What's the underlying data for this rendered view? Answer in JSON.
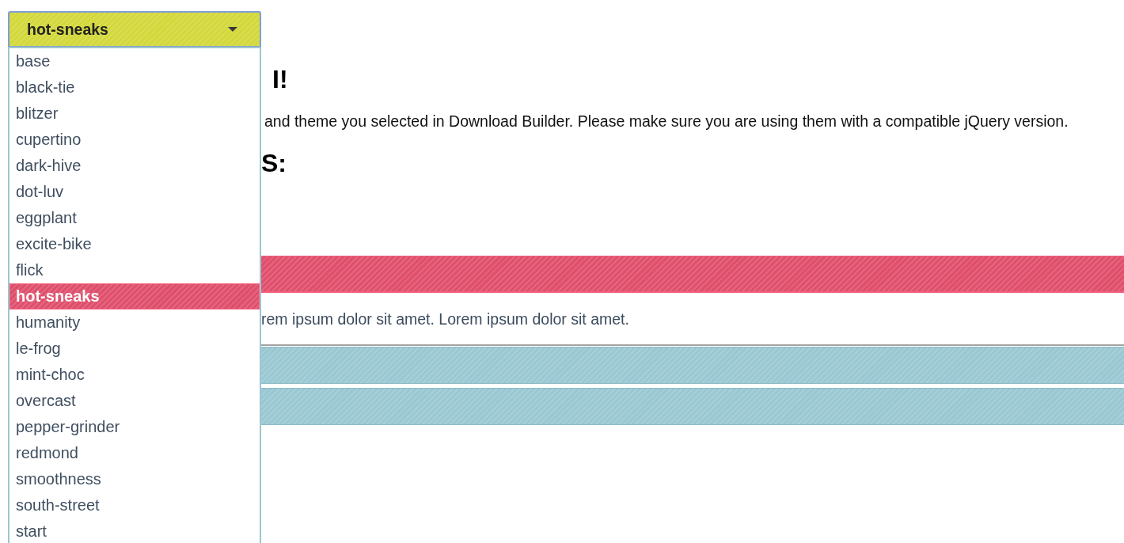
{
  "theme_select": {
    "value": "hot-sneaks",
    "open": true
  },
  "theme_menu": {
    "items": [
      {
        "label": "base",
        "selected": false
      },
      {
        "label": "black-tie",
        "selected": false
      },
      {
        "label": "blitzer",
        "selected": false
      },
      {
        "label": "cupertino",
        "selected": false
      },
      {
        "label": "dark-hive",
        "selected": false
      },
      {
        "label": "dot-luv",
        "selected": false
      },
      {
        "label": "eggplant",
        "selected": false
      },
      {
        "label": "excite-bike",
        "selected": false
      },
      {
        "label": "flick",
        "selected": false
      },
      {
        "label": "hot-sneaks",
        "selected": true
      },
      {
        "label": "humanity",
        "selected": false
      },
      {
        "label": "le-frog",
        "selected": false
      },
      {
        "label": "mint-choc",
        "selected": false
      },
      {
        "label": "overcast",
        "selected": false
      },
      {
        "label": "pepper-grinder",
        "selected": false
      },
      {
        "label": "redmond",
        "selected": false
      },
      {
        "label": "smoothness",
        "selected": false
      },
      {
        "label": "south-street",
        "selected": false
      },
      {
        "label": "start",
        "selected": false
      }
    ]
  },
  "page": {
    "heading": "I!",
    "intro": "and theme you selected in Download Builder. Please make sure you are using them with a compatible jQuery version.",
    "subheading": "S:"
  },
  "accordion": {
    "sections": [
      {
        "expanded": true,
        "content": "rem ipsum dolor sit amet. Lorem ipsum dolor sit amet."
      },
      {
        "expanded": false
      },
      {
        "expanded": false
      }
    ]
  }
}
